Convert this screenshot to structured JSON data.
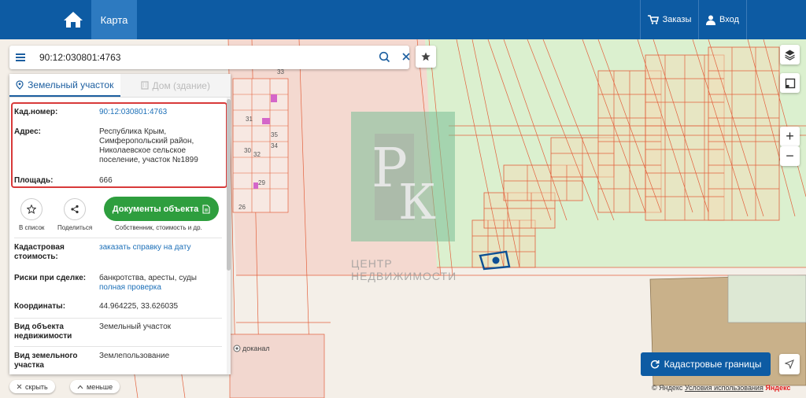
{
  "header": {
    "map_tab": "Карта",
    "orders": "Заказы",
    "login": "Вход"
  },
  "search": {
    "value": "90:12:030801:4763"
  },
  "panel": {
    "tab_land": "Земельный участок",
    "tab_house": "Дом (здание)",
    "cad_number_label": "Кад.номер:",
    "cad_number_value": "90:12:030801:4763",
    "address_label": "Адрес:",
    "address_value": "Республика Крым, Симферопольский район, Николаевское сельское поселение, участок №1899",
    "area_label": "Площадь:",
    "area_value": "666",
    "add_to_list": "В список",
    "share": "Поделиться",
    "docs_button": "Документы объекта",
    "docs_sub": "Собственник, стоимость и др.",
    "cad_cost_label": "Кадастровая стоимость:",
    "cad_cost_value": "заказать справку на дату",
    "risks_label": "Риски при сделке:",
    "risks_value": "банкротства, аресты, суды",
    "risks_link": "полная проверка",
    "coords_label": "Координаты:",
    "coords_value": "44.964225, 33.626035",
    "object_type_label": "Вид объекта недвижимости",
    "object_type_value": "Земельный участок",
    "land_type_label": "Вид земельного участка",
    "land_type_value": "Землепользование"
  },
  "map": {
    "watermark_line1": "ЦЕНТР",
    "watermark_line2": "НЕДВИЖИМОСТИ",
    "watermark_logo": "РК",
    "poi_label": "доканал",
    "plot_numbers": [
      "33",
      "31",
      "35",
      "30",
      "34",
      "32",
      "29",
      "26"
    ]
  },
  "controls": {
    "zoom_in": "+",
    "zoom_out": "−",
    "cad_borders": "Кадастровые границы",
    "hide": "скрыть",
    "less": "меньше"
  },
  "footer": {
    "copyright": "© Яндекс",
    "terms": "Условия использования",
    "brand": "Яндекс"
  },
  "colors": {
    "header_bg": "#0d5ba3",
    "accent_green": "#2e9e3e",
    "highlight_red": "#d83a3a",
    "parcel_line": "#e2603c"
  }
}
